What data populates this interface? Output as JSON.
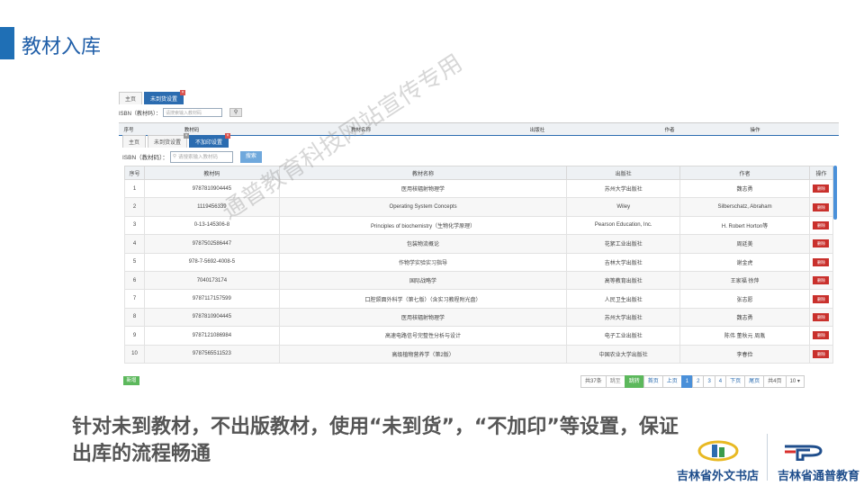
{
  "slide": {
    "title": "教材入库",
    "caption": "针对未到教材，不出版教材，使用“未到货”，“不加印”等设置，保证出库的流程畅通",
    "watermark": "通普教育科技网站宣传专用",
    "brands": [
      "吉林省外文书店",
      "吉林省通普教育"
    ],
    "accent_color": "#1f6fb5"
  },
  "back_window": {
    "tabs": [
      "主页",
      "未到货设置"
    ],
    "active_tab": 1,
    "search_label": "ISBN（教材码）：",
    "search_placeholder": "请搜索输入教材码",
    "search_icon": "search-icon",
    "columns": [
      "序号",
      "教材码",
      "教材名称",
      "出版社",
      "作者",
      "操作"
    ]
  },
  "front_window": {
    "tabs": [
      "主页",
      "未到货设置",
      "不加印设置"
    ],
    "active_tab": 2,
    "search_label": "ISBN（教材码）：",
    "search_placeholder": "请搜索输入教材码",
    "search_button": "搜索",
    "columns": [
      "序号",
      "教材码",
      "教材名称",
      "出版社",
      "作者",
      "操作"
    ],
    "delete_label": "删除",
    "rows": [
      [
        "1",
        "9787810904445",
        "医用核辐射物理学",
        "苏州大学出版社",
        "魏志勇"
      ],
      [
        "2",
        "1119456339",
        "Operating System Concepts",
        "Wiley",
        "Silberschatz, Abraham"
      ],
      [
        "3",
        "0-13-145306-8",
        "Principles of biochemistry（生物化学原理）",
        "Pearson Education, Inc.",
        "H. Robert Horton等"
      ],
      [
        "4",
        "9787502586447",
        "包装物流概论",
        "花絮工业出版社",
        "周廷美"
      ],
      [
        "5",
        "978-7-5692-4008-5",
        "作物学实验实习指导",
        "吉林大学出版社",
        "谢金虎"
      ],
      [
        "6",
        "7040173174",
        "国际战略学",
        "高等教育出版社",
        "王家福 徐萍"
      ],
      [
        "7",
        "9787117157599",
        "口腔颌面外科学（第七版）（含实习教程附光盘）",
        "人民卫生出版社",
        "张志愿"
      ],
      [
        "8",
        "9787810904445",
        "医用核辐射物理学",
        "苏州大学出版社",
        "魏志勇"
      ],
      [
        "9",
        "9787121086984",
        "高速电路信号完整性分析与设计",
        "电子工业出版社",
        "陈伟 董秋元 周胤"
      ],
      [
        "10",
        "9787565511523",
        "高级植物营养学（第2版）",
        "中国农业大学出版社",
        "李春俭"
      ]
    ],
    "add_button": "新增"
  },
  "pager": {
    "total": "共37条",
    "jump": "跳至",
    "go": "跳转",
    "first": "首页",
    "prev": "上页",
    "pages": [
      "1",
      "2",
      "3",
      "4"
    ],
    "current": "1",
    "next": "下页",
    "last": "尾页",
    "page_count": "共4页",
    "page_size": "10"
  }
}
